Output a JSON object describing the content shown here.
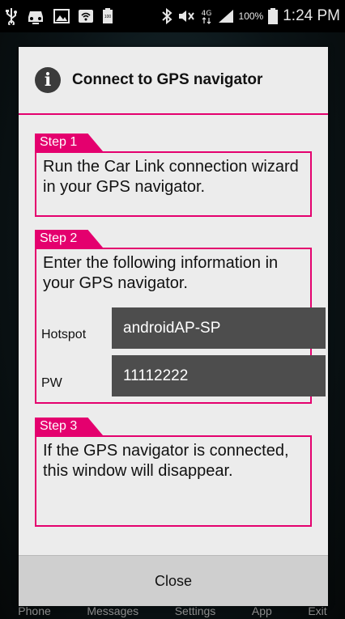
{
  "status_bar": {
    "time": "1:24 PM",
    "battery_percent": "100%",
    "network_type": "4G",
    "icons": [
      "usb-icon",
      "car-icon",
      "image-icon",
      "wifi-hotspot-icon",
      "battery-small-icon",
      "bluetooth-icon",
      "mute-icon",
      "network-icon",
      "signal-icon",
      "battery-icon"
    ]
  },
  "background_nav": {
    "items": [
      "Phone",
      "Messages",
      "Settings",
      "App",
      "Exit"
    ]
  },
  "dialog": {
    "title": "Connect to GPS navigator",
    "icon": "info-icon",
    "accent_color": "#e4006e",
    "steps": [
      {
        "label": "Step 1",
        "text": "Run the Car Link connection wizard in your GPS navigator."
      },
      {
        "label": "Step 2",
        "text": "Enter the following information in your GPS navigator."
      },
      {
        "label": "Step 3",
        "text": "If the GPS navigator is connected, this window will disappear."
      }
    ],
    "fields": {
      "hotspot": {
        "label": "Hotspot",
        "value": "androidAP-SP"
      },
      "pw": {
        "label": "PW",
        "value": "11112222"
      }
    },
    "close_label": "Close"
  }
}
